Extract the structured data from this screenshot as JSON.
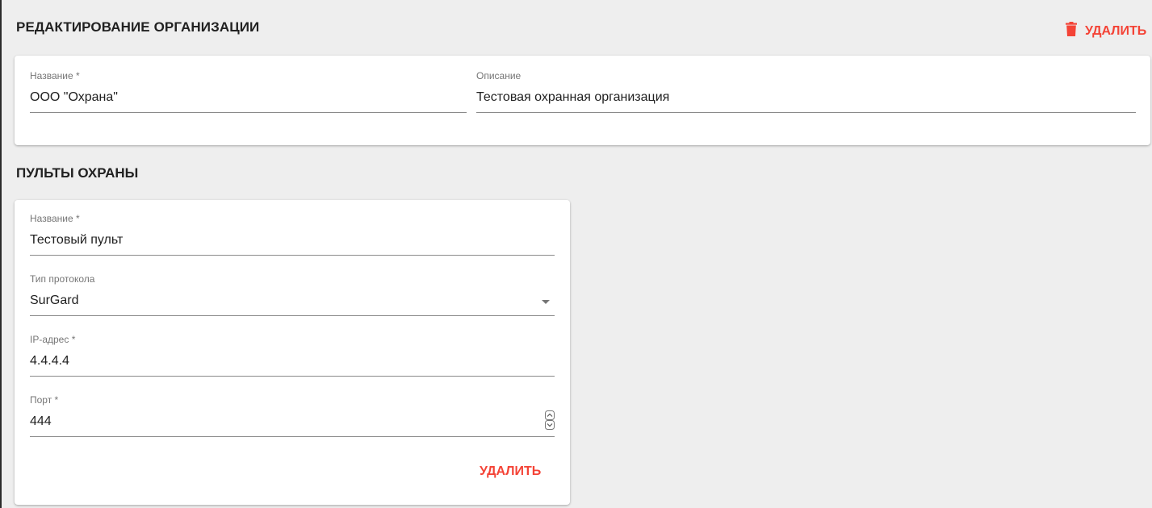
{
  "header": {
    "title": "РЕДАКТИРОВАНИЕ ОРГАНИЗАЦИИ",
    "delete_label": "УДАЛИТЬ",
    "delete_icon": "trash-icon",
    "accent_color": "#f44336"
  },
  "organization": {
    "name_label": "Название *",
    "name_value": "ООО \"Охрана\"",
    "description_label": "Описание",
    "description_value": "Тестовая охранная организация"
  },
  "consoles_section": {
    "title": "ПУЛЬТЫ ОХРАНЫ",
    "items": [
      {
        "name_label": "Название *",
        "name_value": "Тестовый пульт",
        "protocol_label": "Тип протокола",
        "protocol_value": "SurGard",
        "ip_label": "IP-адрес *",
        "ip_value": "4.4.4.4",
        "port_label": "Порт *",
        "port_value": "444",
        "delete_label": "УДАЛИТЬ"
      }
    ]
  }
}
